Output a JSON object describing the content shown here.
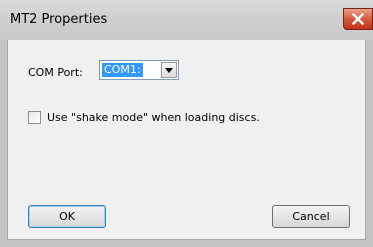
{
  "window": {
    "title": "MT2 Properties",
    "close_icon": "close-icon"
  },
  "com_port": {
    "label": "COM Port:",
    "selected": "COM1:"
  },
  "shake_mode": {
    "label": "Use \"shake mode\" when loading discs.",
    "checked": false
  },
  "buttons": {
    "ok": "OK",
    "cancel": "Cancel"
  },
  "colors": {
    "close_button": "#d65a3d",
    "selection": "#3399ff"
  }
}
